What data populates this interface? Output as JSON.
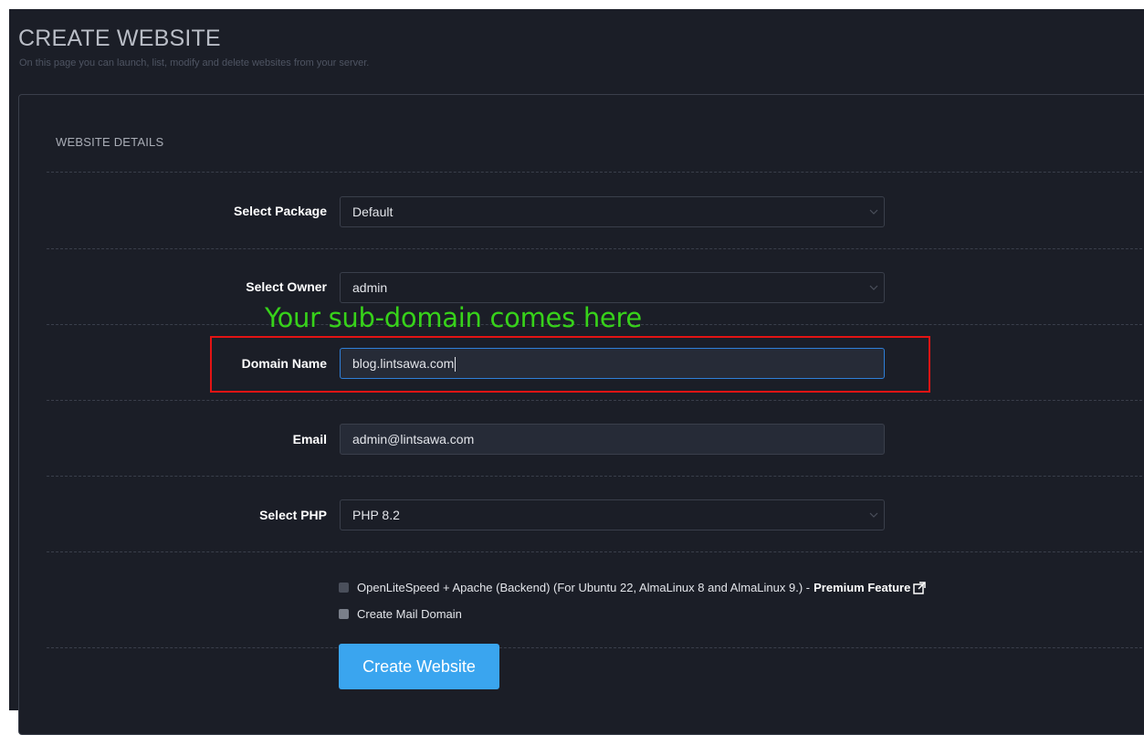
{
  "header": {
    "title": "CREATE WEBSITE",
    "subtitle": "On this page you can launch, list, modify and delete websites from your server."
  },
  "panel": {
    "title": "WEBSITE DETAILS"
  },
  "form": {
    "package": {
      "label": "Select Package",
      "value": "Default"
    },
    "owner": {
      "label": "Select Owner",
      "value": "admin"
    },
    "domain": {
      "label": "Domain Name",
      "value": "blog.lintsawa.com"
    },
    "email": {
      "label": "Email",
      "value": "admin@lintsawa.com"
    },
    "php": {
      "label": "Select PHP",
      "value": "PHP 8.2"
    },
    "ols_apache": {
      "label": "OpenLiteSpeed + Apache (Backend) (For Ubuntu 22, AlmaLinux 8 and AlmaLinux 9.) -",
      "premium": "Premium Feature",
      "checked": false
    },
    "mail_domain": {
      "label": "Create Mail Domain",
      "checked": false
    },
    "submit_label": "Create Website"
  },
  "annotation": {
    "text": "Your sub-domain comes here",
    "color": "#37d21a",
    "box_color": "#e31414"
  },
  "colors": {
    "background": "#1b1e27",
    "accent": "#3aa5ef",
    "focus_border": "#2f7fd8"
  },
  "icons": {
    "select_arrow": "chevron-down-icon",
    "external_link": "external-link-icon"
  }
}
